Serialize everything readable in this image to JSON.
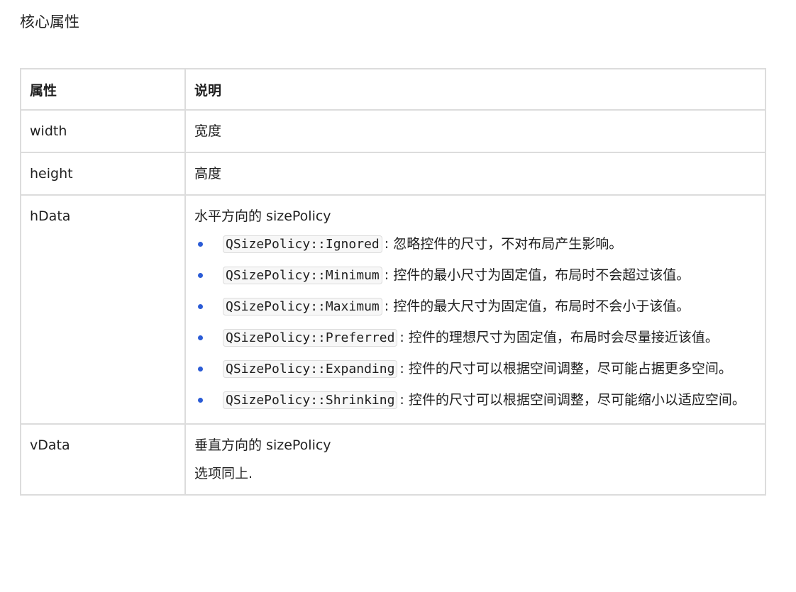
{
  "title": "核心属性",
  "table": {
    "headers": [
      "属性",
      "说明"
    ],
    "rows": [
      {
        "name": "width",
        "desc": "宽度"
      },
      {
        "name": "height",
        "desc": "高度"
      },
      {
        "name": "hData",
        "desc": "水平方向的 sizePolicy",
        "options": [
          {
            "code": "QSizePolicy::Ignored",
            "text": ": 忽略控件的尺寸，不对布局产生影响。"
          },
          {
            "code": "QSizePolicy::Minimum",
            "text": ": 控件的最小尺寸为固定值，布局时不会超过该值。"
          },
          {
            "code": "QSizePolicy::Maximum",
            "text": ": 控件的最大尺寸为固定值，布局时不会小于该值。"
          },
          {
            "code": "QSizePolicy::Preferred",
            "text": ": 控件的理想尺寸为固定值，布局时会尽量接近该值。"
          },
          {
            "code": "QSizePolicy::Expanding",
            "text": ": 控件的尺寸可以根据空间调整，尽可能占据更多空间。"
          },
          {
            "code": "QSizePolicy::Shrinking",
            "text": ": 控件的尺寸可以根据空间调整，尽可能缩小以适应空间。"
          }
        ]
      },
      {
        "name": "vData",
        "desc": "垂直方向的 sizePolicy",
        "note": "选项同上."
      }
    ]
  }
}
